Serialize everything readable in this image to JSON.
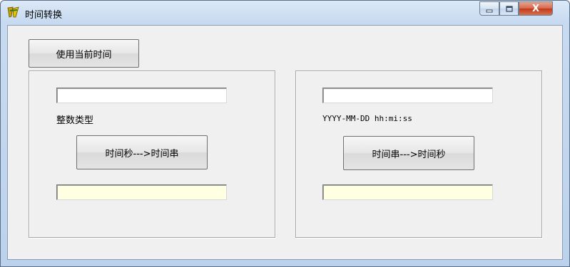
{
  "window": {
    "title": "时间转换",
    "icon": "app-icon",
    "controls": {
      "minimize_icon": "minimize-icon",
      "maximize_icon": "maximize-icon",
      "close_glyph": "X"
    }
  },
  "toolbar": {
    "use_current_time_label": "使用当前时间"
  },
  "left_group": {
    "input_value": "",
    "type_label": "整数类型",
    "convert_button_label": "时间秒--->时间串",
    "output_value": ""
  },
  "right_group": {
    "input_value": "",
    "format_label": "YYYY-MM-DD hh:mi:ss",
    "convert_button_label": "时间串--->时间秒",
    "output_value": ""
  },
  "colors": {
    "client_bg": "#f0f0f0",
    "output_bg": "#ffffe1",
    "close_button": "#c2391b"
  }
}
